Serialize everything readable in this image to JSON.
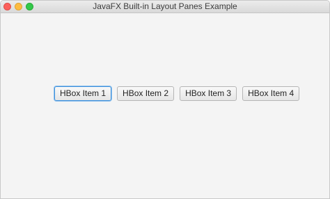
{
  "window": {
    "title": "JavaFX Built-in Layout Panes Example"
  },
  "hbox": {
    "items": [
      {
        "label": "HBox Item 1"
      },
      {
        "label": "HBox Item 2"
      },
      {
        "label": "HBox Item 3"
      },
      {
        "label": "HBox Item 4"
      }
    ]
  }
}
